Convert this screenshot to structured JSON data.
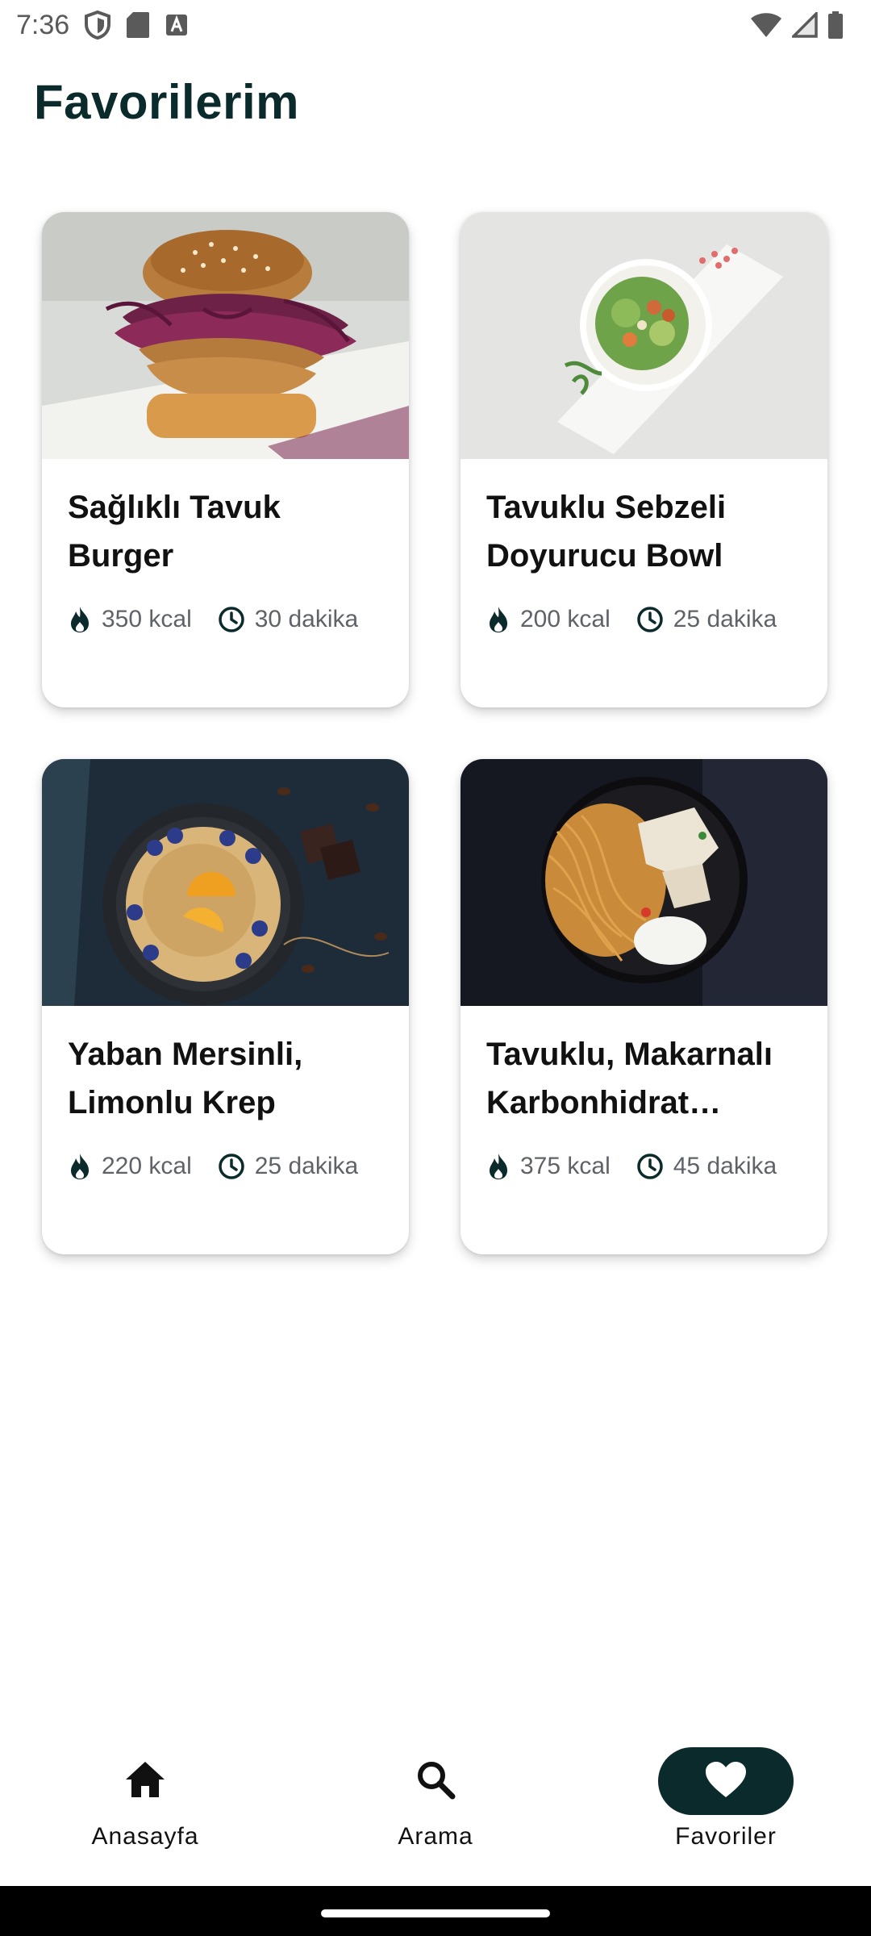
{
  "status_bar": {
    "time": "7:36",
    "icons": [
      "shield-icon",
      "sd-card-icon",
      "keyboard-a-icon",
      "wifi-icon",
      "signal-icon",
      "battery-icon"
    ]
  },
  "page": {
    "title": "Favorilerim"
  },
  "favorites": [
    {
      "title": "Sağlıklı Tavuk Burger",
      "calories": "350 kcal",
      "duration": "30 dakika",
      "image": "burger-photo"
    },
    {
      "title": "Tavuklu Sebzeli Doyurucu Bowl",
      "calories": "200 kcal",
      "duration": "25 dakika",
      "image": "salad-bowl-photo"
    },
    {
      "title": "Yaban Mersinli, Limonlu Krep",
      "calories": "220 kcal",
      "duration": "25 dakika",
      "image": "pancake-photo"
    },
    {
      "title": "Tavuklu, Makarnalı Karbonhidrat Deposu",
      "calories": "375 kcal",
      "duration": "45 dakika",
      "image": "noodle-plate-photo"
    }
  ],
  "bottom_nav": {
    "items": [
      {
        "label": "Anasayfa",
        "icon": "home-icon",
        "active": false
      },
      {
        "label": "Arama",
        "icon": "search-icon",
        "active": false
      },
      {
        "label": "Favoriler",
        "icon": "heart-icon",
        "active": true
      }
    ]
  },
  "colors": {
    "brand_dark": "#0b2a2b",
    "meta_text": "#5f6368",
    "card_bg": "#ffffff"
  }
}
